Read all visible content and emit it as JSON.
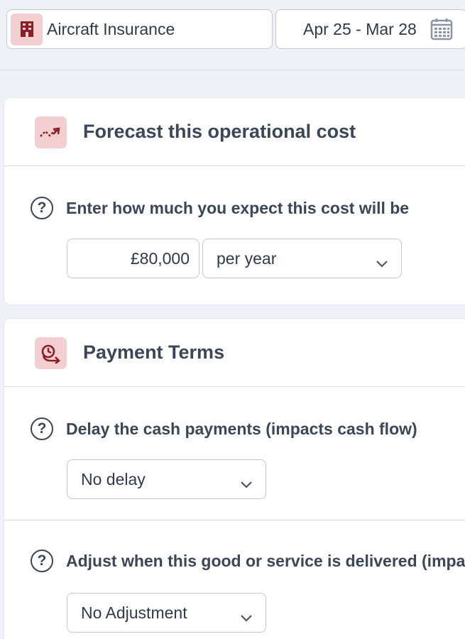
{
  "header": {
    "item_name": "Aircraft Insurance",
    "item_icon": "building-icon",
    "date_range": "Apr 25 - Mar 28",
    "date_icon": "calendar-icon"
  },
  "forecast": {
    "title": "Forecast this operational cost",
    "icon": "trend-up-icon",
    "question": "Enter how much you expect this cost will be",
    "amount": "£80,000",
    "period": "per year"
  },
  "payment_terms": {
    "title": "Payment Terms",
    "icon": "clock-arrow-icon",
    "delay_question": "Delay the cash payments (impacts cash flow)",
    "delay_value": "No delay",
    "delivery_question": "Adjust when this good or service is delivered (impa",
    "delivery_value": "No Adjustment"
  },
  "colors": {
    "accent": "#8b1f25",
    "accent_bg": "#f3cfd1",
    "text": "#2f3a4a",
    "border": "#c3c9d1",
    "background": "#eef1f5"
  }
}
